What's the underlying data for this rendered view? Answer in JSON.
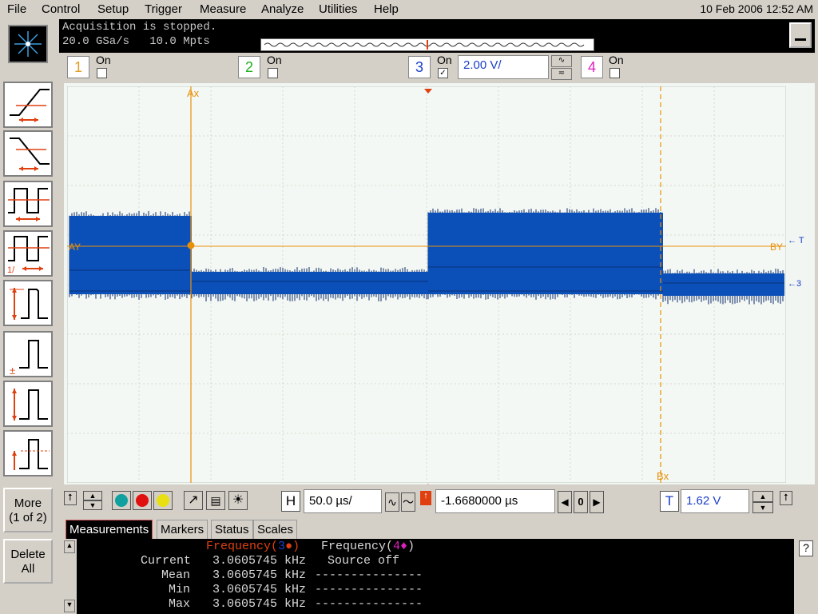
{
  "menu": {
    "items": [
      "File",
      "Control",
      "Setup",
      "Trigger",
      "Measure",
      "Analyze",
      "Utilities",
      "Help"
    ],
    "datetime": "10 Feb 2006 12:52 AM"
  },
  "status": {
    "line1": "Acquisition is stopped.",
    "line2": "20.0 GSa/s   10.0 Mpts"
  },
  "channels": [
    {
      "num": "1",
      "on_label": "On",
      "checked": false,
      "color": "#e0a020"
    },
    {
      "num": "2",
      "on_label": "On",
      "checked": false,
      "color": "#20b020"
    },
    {
      "num": "3",
      "on_label": "On",
      "checked": true,
      "color": "#1a3ec8",
      "scale": "2.00 V/"
    },
    {
      "num": "4",
      "on_label": "On",
      "checked": false,
      "color": "#e020c0"
    }
  ],
  "markers": {
    "ax": "Ax",
    "bx": "Bx",
    "ay": "AY",
    "by": "BY",
    "trig": "T",
    "ch3": "3"
  },
  "left_buttons": {
    "more_line1": "More",
    "more_line2": "(1 of 2)",
    "delete_line1": "Delete",
    "delete_line2": "All",
    "period_label": "1/"
  },
  "horizontal": {
    "label": "H",
    "scale": "50.0 µs/",
    "position": "-1.6680000 µs",
    "ref": "0"
  },
  "trigger": {
    "label": "T",
    "level": "1.62 V"
  },
  "tabs": [
    "Measurements",
    "Markers",
    "Status",
    "Scales"
  ],
  "measurements": {
    "col1_header": "Frequency(",
    "col1_src": "3",
    "col2_header": "Frequency(",
    "col2_src": "4",
    "source_off": "Source off",
    "rows": [
      {
        "label": "Current",
        "value": "3.0605745 kHz",
        "v2": ""
      },
      {
        "label": "Mean",
        "value": "3.0605745 kHz",
        "v2": "---------------"
      },
      {
        "label": "Min",
        "value": "3.0605745 kHz",
        "v2": "---------------"
      },
      {
        "label": "Max",
        "value": "3.0605745 kHz",
        "v2": "---------------"
      }
    ]
  },
  "colors": {
    "waveform": "#0b4fb8",
    "marker": "#e8900a",
    "grid": "#c8d8c8",
    "trace_dark": "#0a2a6a"
  }
}
